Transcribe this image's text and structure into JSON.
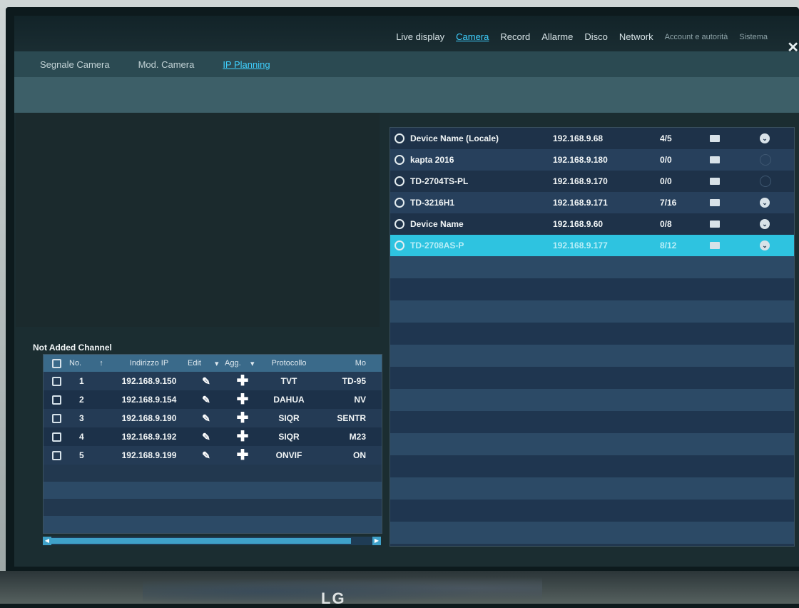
{
  "menu": {
    "items": [
      {
        "label": "Live display",
        "active": false
      },
      {
        "label": "Camera",
        "active": true
      },
      {
        "label": "Record",
        "active": false
      },
      {
        "label": "Allarme",
        "active": false
      },
      {
        "label": "Disco",
        "active": false
      },
      {
        "label": "Network",
        "active": false
      },
      {
        "label": "Account e autorità",
        "active": false
      },
      {
        "label": "Sistema",
        "active": false
      }
    ],
    "close_label": "✕"
  },
  "subtabs": [
    {
      "label": "Segnale Camera",
      "active": false
    },
    {
      "label": "Mod. Camera",
      "active": false
    },
    {
      "label": "IP Planning",
      "active": true
    }
  ],
  "devices": {
    "rows": [
      {
        "name": "Device Name (Locale)",
        "ip": "192.168.9.68",
        "channels": "4/5",
        "expand": true
      },
      {
        "name": "kapta 2016",
        "ip": "192.168.9.180",
        "channels": "0/0",
        "expand": false
      },
      {
        "name": "TD-2704TS-PL",
        "ip": "192.168.9.170",
        "channels": "0/0",
        "expand": false
      },
      {
        "name": "TD-3216H1",
        "ip": "192.168.9.171",
        "channels": "7/16",
        "expand": true
      },
      {
        "name": "Device Name",
        "ip": "192.168.9.60",
        "channels": "0/8",
        "expand": true
      },
      {
        "name": "TD-2708AS-P",
        "ip": "192.168.9.177",
        "channels": "8/12",
        "expand": true,
        "selected": true
      }
    ]
  },
  "channel_panel": {
    "title": "Not Added Channel",
    "headers": {
      "no": "No.",
      "sort": "↑",
      "ip": "Indirizzo IP",
      "edit": "Edit",
      "add": "Agg.",
      "protocol": "Protocollo",
      "model": "Mo"
    },
    "rows": [
      {
        "no": "1",
        "ip": "192.168.9.150",
        "protocol": "TVT",
        "model": "TD-95"
      },
      {
        "no": "2",
        "ip": "192.168.9.154",
        "protocol": "DAHUA",
        "model": "NV"
      },
      {
        "no": "3",
        "ip": "192.168.9.190",
        "protocol": "SIQR",
        "model": "SENTR"
      },
      {
        "no": "4",
        "ip": "192.168.9.192",
        "protocol": "SIQR",
        "model": "M23"
      },
      {
        "no": "5",
        "ip": "192.168.9.199",
        "protocol": "ONVIF",
        "model": "ON"
      }
    ]
  },
  "brand": {
    "logo": "LG"
  },
  "colors": {
    "accent": "#3fd0ff",
    "selected_row": "#2ec3e0",
    "header": "#3a6a8a"
  }
}
